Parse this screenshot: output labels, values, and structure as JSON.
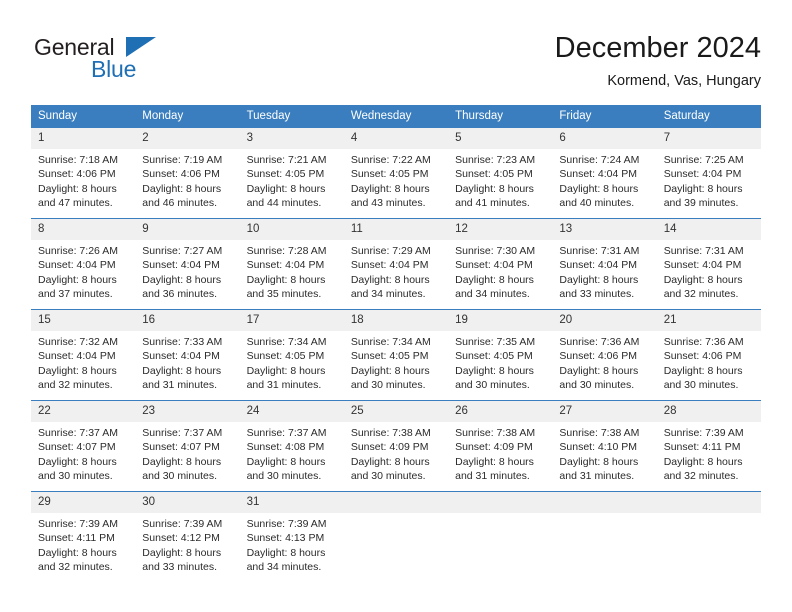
{
  "brand": {
    "name_part1": "General",
    "name_part2": "Blue",
    "triangle_icon": "triangle-icon",
    "accent_color": "#1f6fb5"
  },
  "header": {
    "title": "December 2024",
    "subtitle": "Kormend, Vas, Hungary"
  },
  "theme": {
    "header_bg": "#3a7ebf",
    "daynum_bg": "#f0f0f0",
    "row_border": "#3a7ebf"
  },
  "weekday_headers": [
    "Sunday",
    "Monday",
    "Tuesday",
    "Wednesday",
    "Thursday",
    "Friday",
    "Saturday"
  ],
  "weeks": [
    {
      "days": [
        {
          "num": "1",
          "sunrise": "Sunrise: 7:18 AM",
          "sunset": "Sunset: 4:06 PM",
          "daylight_1": "Daylight: 8 hours",
          "daylight_2": "and 47 minutes."
        },
        {
          "num": "2",
          "sunrise": "Sunrise: 7:19 AM",
          "sunset": "Sunset: 4:06 PM",
          "daylight_1": "Daylight: 8 hours",
          "daylight_2": "and 46 minutes."
        },
        {
          "num": "3",
          "sunrise": "Sunrise: 7:21 AM",
          "sunset": "Sunset: 4:05 PM",
          "daylight_1": "Daylight: 8 hours",
          "daylight_2": "and 44 minutes."
        },
        {
          "num": "4",
          "sunrise": "Sunrise: 7:22 AM",
          "sunset": "Sunset: 4:05 PM",
          "daylight_1": "Daylight: 8 hours",
          "daylight_2": "and 43 minutes."
        },
        {
          "num": "5",
          "sunrise": "Sunrise: 7:23 AM",
          "sunset": "Sunset: 4:05 PM",
          "daylight_1": "Daylight: 8 hours",
          "daylight_2": "and 41 minutes."
        },
        {
          "num": "6",
          "sunrise": "Sunrise: 7:24 AM",
          "sunset": "Sunset: 4:04 PM",
          "daylight_1": "Daylight: 8 hours",
          "daylight_2": "and 40 minutes."
        },
        {
          "num": "7",
          "sunrise": "Sunrise: 7:25 AM",
          "sunset": "Sunset: 4:04 PM",
          "daylight_1": "Daylight: 8 hours",
          "daylight_2": "and 39 minutes."
        }
      ]
    },
    {
      "days": [
        {
          "num": "8",
          "sunrise": "Sunrise: 7:26 AM",
          "sunset": "Sunset: 4:04 PM",
          "daylight_1": "Daylight: 8 hours",
          "daylight_2": "and 37 minutes."
        },
        {
          "num": "9",
          "sunrise": "Sunrise: 7:27 AM",
          "sunset": "Sunset: 4:04 PM",
          "daylight_1": "Daylight: 8 hours",
          "daylight_2": "and 36 minutes."
        },
        {
          "num": "10",
          "sunrise": "Sunrise: 7:28 AM",
          "sunset": "Sunset: 4:04 PM",
          "daylight_1": "Daylight: 8 hours",
          "daylight_2": "and 35 minutes."
        },
        {
          "num": "11",
          "sunrise": "Sunrise: 7:29 AM",
          "sunset": "Sunset: 4:04 PM",
          "daylight_1": "Daylight: 8 hours",
          "daylight_2": "and 34 minutes."
        },
        {
          "num": "12",
          "sunrise": "Sunrise: 7:30 AM",
          "sunset": "Sunset: 4:04 PM",
          "daylight_1": "Daylight: 8 hours",
          "daylight_2": "and 34 minutes."
        },
        {
          "num": "13",
          "sunrise": "Sunrise: 7:31 AM",
          "sunset": "Sunset: 4:04 PM",
          "daylight_1": "Daylight: 8 hours",
          "daylight_2": "and 33 minutes."
        },
        {
          "num": "14",
          "sunrise": "Sunrise: 7:31 AM",
          "sunset": "Sunset: 4:04 PM",
          "daylight_1": "Daylight: 8 hours",
          "daylight_2": "and 32 minutes."
        }
      ]
    },
    {
      "days": [
        {
          "num": "15",
          "sunrise": "Sunrise: 7:32 AM",
          "sunset": "Sunset: 4:04 PM",
          "daylight_1": "Daylight: 8 hours",
          "daylight_2": "and 32 minutes."
        },
        {
          "num": "16",
          "sunrise": "Sunrise: 7:33 AM",
          "sunset": "Sunset: 4:04 PM",
          "daylight_1": "Daylight: 8 hours",
          "daylight_2": "and 31 minutes."
        },
        {
          "num": "17",
          "sunrise": "Sunrise: 7:34 AM",
          "sunset": "Sunset: 4:05 PM",
          "daylight_1": "Daylight: 8 hours",
          "daylight_2": "and 31 minutes."
        },
        {
          "num": "18",
          "sunrise": "Sunrise: 7:34 AM",
          "sunset": "Sunset: 4:05 PM",
          "daylight_1": "Daylight: 8 hours",
          "daylight_2": "and 30 minutes."
        },
        {
          "num": "19",
          "sunrise": "Sunrise: 7:35 AM",
          "sunset": "Sunset: 4:05 PM",
          "daylight_1": "Daylight: 8 hours",
          "daylight_2": "and 30 minutes."
        },
        {
          "num": "20",
          "sunrise": "Sunrise: 7:36 AM",
          "sunset": "Sunset: 4:06 PM",
          "daylight_1": "Daylight: 8 hours",
          "daylight_2": "and 30 minutes."
        },
        {
          "num": "21",
          "sunrise": "Sunrise: 7:36 AM",
          "sunset": "Sunset: 4:06 PM",
          "daylight_1": "Daylight: 8 hours",
          "daylight_2": "and 30 minutes."
        }
      ]
    },
    {
      "days": [
        {
          "num": "22",
          "sunrise": "Sunrise: 7:37 AM",
          "sunset": "Sunset: 4:07 PM",
          "daylight_1": "Daylight: 8 hours",
          "daylight_2": "and 30 minutes."
        },
        {
          "num": "23",
          "sunrise": "Sunrise: 7:37 AM",
          "sunset": "Sunset: 4:07 PM",
          "daylight_1": "Daylight: 8 hours",
          "daylight_2": "and 30 minutes."
        },
        {
          "num": "24",
          "sunrise": "Sunrise: 7:37 AM",
          "sunset": "Sunset: 4:08 PM",
          "daylight_1": "Daylight: 8 hours",
          "daylight_2": "and 30 minutes."
        },
        {
          "num": "25",
          "sunrise": "Sunrise: 7:38 AM",
          "sunset": "Sunset: 4:09 PM",
          "daylight_1": "Daylight: 8 hours",
          "daylight_2": "and 30 minutes."
        },
        {
          "num": "26",
          "sunrise": "Sunrise: 7:38 AM",
          "sunset": "Sunset: 4:09 PM",
          "daylight_1": "Daylight: 8 hours",
          "daylight_2": "and 31 minutes."
        },
        {
          "num": "27",
          "sunrise": "Sunrise: 7:38 AM",
          "sunset": "Sunset: 4:10 PM",
          "daylight_1": "Daylight: 8 hours",
          "daylight_2": "and 31 minutes."
        },
        {
          "num": "28",
          "sunrise": "Sunrise: 7:39 AM",
          "sunset": "Sunset: 4:11 PM",
          "daylight_1": "Daylight: 8 hours",
          "daylight_2": "and 32 minutes."
        }
      ]
    },
    {
      "days": [
        {
          "num": "29",
          "sunrise": "Sunrise: 7:39 AM",
          "sunset": "Sunset: 4:11 PM",
          "daylight_1": "Daylight: 8 hours",
          "daylight_2": "and 32 minutes."
        },
        {
          "num": "30",
          "sunrise": "Sunrise: 7:39 AM",
          "sunset": "Sunset: 4:12 PM",
          "daylight_1": "Daylight: 8 hours",
          "daylight_2": "and 33 minutes."
        },
        {
          "num": "31",
          "sunrise": "Sunrise: 7:39 AM",
          "sunset": "Sunset: 4:13 PM",
          "daylight_1": "Daylight: 8 hours",
          "daylight_2": "and 34 minutes."
        },
        {
          "num": "",
          "sunrise": "",
          "sunset": "",
          "daylight_1": "",
          "daylight_2": ""
        },
        {
          "num": "",
          "sunrise": "",
          "sunset": "",
          "daylight_1": "",
          "daylight_2": ""
        },
        {
          "num": "",
          "sunrise": "",
          "sunset": "",
          "daylight_1": "",
          "daylight_2": ""
        },
        {
          "num": "",
          "sunrise": "",
          "sunset": "",
          "daylight_1": "",
          "daylight_2": ""
        }
      ]
    }
  ]
}
